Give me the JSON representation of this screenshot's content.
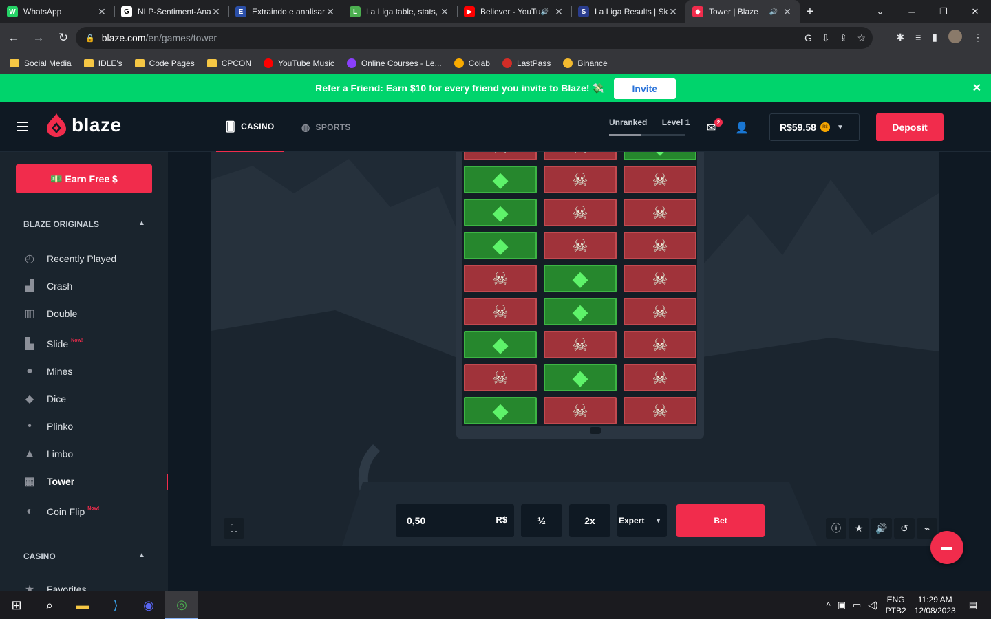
{
  "browser": {
    "tabs": [
      {
        "title": "WhatsApp",
        "color": "#25d366",
        "glyph": "W",
        "audio": false,
        "active": false
      },
      {
        "title": "NLP-Sentiment-Analysis",
        "color": "#ffffff",
        "glyph": "G",
        "audio": false,
        "active": false
      },
      {
        "title": "Extraindo e analisando",
        "color": "#2b4fa8",
        "glyph": "E",
        "audio": false,
        "active": false
      },
      {
        "title": "La Liga table, stats,",
        "color": "#4caf50",
        "glyph": "L",
        "audio": false,
        "active": false
      },
      {
        "title": "Believer - YouTube",
        "color": "#ff0000",
        "glyph": "▶",
        "audio": true,
        "active": false
      },
      {
        "title": "La Liga Results | Sky",
        "color": "#2a3d8f",
        "glyph": "S",
        "audio": false,
        "active": false
      },
      {
        "title": "Tower | Blaze",
        "color": "#f12c4c",
        "glyph": "◆",
        "audio": true,
        "active": true
      }
    ],
    "url_host": "blaze.com",
    "url_path": "/en/games/tower",
    "bookmarks": [
      {
        "label": "Social Media",
        "kind": "folder"
      },
      {
        "label": "IDLE's",
        "kind": "folder"
      },
      {
        "label": "Code Pages",
        "kind": "folder"
      },
      {
        "label": "CPCON",
        "kind": "folder"
      },
      {
        "label": "YouTube Music",
        "kind": "site",
        "color": "#ff0000"
      },
      {
        "label": "Online Courses - Le...",
        "kind": "site",
        "color": "#8a3ffc"
      },
      {
        "label": "Colab",
        "kind": "site",
        "color": "#f9ab00"
      },
      {
        "label": "LastPass",
        "kind": "site",
        "color": "#d32d27"
      },
      {
        "label": "Binance",
        "kind": "site",
        "color": "#f3ba2f"
      }
    ]
  },
  "referral": {
    "text": "Refer a Friend: Earn $10 for every friend you invite to Blaze! 💸",
    "button": "Invite"
  },
  "header": {
    "brand": "blaze",
    "nav": {
      "casino": "CASINO",
      "sports": "SPORTS"
    },
    "rank": {
      "label": "Unranked",
      "level": "Level 1",
      "progress": 0.42
    },
    "mail_count": "2",
    "balance": "R$59.58",
    "coin_label": "R$",
    "deposit": "Deposit"
  },
  "sidebar": {
    "earn": "💵 Earn Free $",
    "originals_title": "BLAZE ORIGINALS",
    "items": [
      {
        "label": "Recently Played",
        "icon": "◴",
        "new": false
      },
      {
        "label": "Crash",
        "icon": "▟",
        "new": false
      },
      {
        "label": "Double",
        "icon": "▥",
        "new": false
      },
      {
        "label": "Slide",
        "icon": "▙",
        "new": true
      },
      {
        "label": "Mines",
        "icon": "●",
        "new": false
      },
      {
        "label": "Dice",
        "icon": "◆",
        "new": false
      },
      {
        "label": "Plinko",
        "icon": "•",
        "new": false
      },
      {
        "label": "Limbo",
        "icon": "▲",
        "new": false
      },
      {
        "label": "Tower",
        "icon": "▦",
        "new": false,
        "active": true
      },
      {
        "label": "Coin Flip",
        "icon": "◐",
        "new": true
      }
    ],
    "new_tag": "Now!",
    "casino_title": "CASINO",
    "favorites": "Favorites"
  },
  "game": {
    "rows": [
      [
        "gem",
        "skull",
        "skull"
      ],
      [
        "gem",
        "skull",
        "skull"
      ],
      [
        "gem",
        "skull",
        "skull"
      ],
      [
        "skull",
        "gem",
        "skull"
      ],
      [
        "skull",
        "gem",
        "skull"
      ],
      [
        "gem",
        "skull",
        "skull"
      ],
      [
        "skull",
        "gem",
        "skull"
      ],
      [
        "gem",
        "skull",
        "skull"
      ]
    ],
    "top_partial_row": [
      "skull",
      "skull",
      "gem"
    ],
    "amount": "0,50",
    "currency": "R$",
    "half": "½",
    "double": "2x",
    "difficulty": "Expert",
    "bet": "Bet"
  },
  "taskbar": {
    "lang": "ENG",
    "layout": "PTB2",
    "time": "11:29 AM",
    "date": "12/08/2023"
  }
}
